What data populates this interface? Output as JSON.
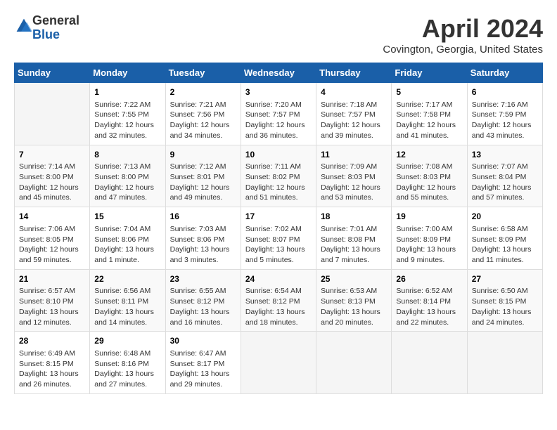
{
  "header": {
    "logo_general": "General",
    "logo_blue": "Blue",
    "month": "April 2024",
    "location": "Covington, Georgia, United States"
  },
  "days_of_week": [
    "Sunday",
    "Monday",
    "Tuesday",
    "Wednesday",
    "Thursday",
    "Friday",
    "Saturday"
  ],
  "weeks": [
    [
      {
        "day": "",
        "info": ""
      },
      {
        "day": "1",
        "info": "Sunrise: 7:22 AM\nSunset: 7:55 PM\nDaylight: 12 hours\nand 32 minutes."
      },
      {
        "day": "2",
        "info": "Sunrise: 7:21 AM\nSunset: 7:56 PM\nDaylight: 12 hours\nand 34 minutes."
      },
      {
        "day": "3",
        "info": "Sunrise: 7:20 AM\nSunset: 7:57 PM\nDaylight: 12 hours\nand 36 minutes."
      },
      {
        "day": "4",
        "info": "Sunrise: 7:18 AM\nSunset: 7:57 PM\nDaylight: 12 hours\nand 39 minutes."
      },
      {
        "day": "5",
        "info": "Sunrise: 7:17 AM\nSunset: 7:58 PM\nDaylight: 12 hours\nand 41 minutes."
      },
      {
        "day": "6",
        "info": "Sunrise: 7:16 AM\nSunset: 7:59 PM\nDaylight: 12 hours\nand 43 minutes."
      }
    ],
    [
      {
        "day": "7",
        "info": "Sunrise: 7:14 AM\nSunset: 8:00 PM\nDaylight: 12 hours\nand 45 minutes."
      },
      {
        "day": "8",
        "info": "Sunrise: 7:13 AM\nSunset: 8:00 PM\nDaylight: 12 hours\nand 47 minutes."
      },
      {
        "day": "9",
        "info": "Sunrise: 7:12 AM\nSunset: 8:01 PM\nDaylight: 12 hours\nand 49 minutes."
      },
      {
        "day": "10",
        "info": "Sunrise: 7:11 AM\nSunset: 8:02 PM\nDaylight: 12 hours\nand 51 minutes."
      },
      {
        "day": "11",
        "info": "Sunrise: 7:09 AM\nSunset: 8:03 PM\nDaylight: 12 hours\nand 53 minutes."
      },
      {
        "day": "12",
        "info": "Sunrise: 7:08 AM\nSunset: 8:03 PM\nDaylight: 12 hours\nand 55 minutes."
      },
      {
        "day": "13",
        "info": "Sunrise: 7:07 AM\nSunset: 8:04 PM\nDaylight: 12 hours\nand 57 minutes."
      }
    ],
    [
      {
        "day": "14",
        "info": "Sunrise: 7:06 AM\nSunset: 8:05 PM\nDaylight: 12 hours\nand 59 minutes."
      },
      {
        "day": "15",
        "info": "Sunrise: 7:04 AM\nSunset: 8:06 PM\nDaylight: 13 hours\nand 1 minute."
      },
      {
        "day": "16",
        "info": "Sunrise: 7:03 AM\nSunset: 8:06 PM\nDaylight: 13 hours\nand 3 minutes."
      },
      {
        "day": "17",
        "info": "Sunrise: 7:02 AM\nSunset: 8:07 PM\nDaylight: 13 hours\nand 5 minutes."
      },
      {
        "day": "18",
        "info": "Sunrise: 7:01 AM\nSunset: 8:08 PM\nDaylight: 13 hours\nand 7 minutes."
      },
      {
        "day": "19",
        "info": "Sunrise: 7:00 AM\nSunset: 8:09 PM\nDaylight: 13 hours\nand 9 minutes."
      },
      {
        "day": "20",
        "info": "Sunrise: 6:58 AM\nSunset: 8:09 PM\nDaylight: 13 hours\nand 11 minutes."
      }
    ],
    [
      {
        "day": "21",
        "info": "Sunrise: 6:57 AM\nSunset: 8:10 PM\nDaylight: 13 hours\nand 12 minutes."
      },
      {
        "day": "22",
        "info": "Sunrise: 6:56 AM\nSunset: 8:11 PM\nDaylight: 13 hours\nand 14 minutes."
      },
      {
        "day": "23",
        "info": "Sunrise: 6:55 AM\nSunset: 8:12 PM\nDaylight: 13 hours\nand 16 minutes."
      },
      {
        "day": "24",
        "info": "Sunrise: 6:54 AM\nSunset: 8:12 PM\nDaylight: 13 hours\nand 18 minutes."
      },
      {
        "day": "25",
        "info": "Sunrise: 6:53 AM\nSunset: 8:13 PM\nDaylight: 13 hours\nand 20 minutes."
      },
      {
        "day": "26",
        "info": "Sunrise: 6:52 AM\nSunset: 8:14 PM\nDaylight: 13 hours\nand 22 minutes."
      },
      {
        "day": "27",
        "info": "Sunrise: 6:50 AM\nSunset: 8:15 PM\nDaylight: 13 hours\nand 24 minutes."
      }
    ],
    [
      {
        "day": "28",
        "info": "Sunrise: 6:49 AM\nSunset: 8:15 PM\nDaylight: 13 hours\nand 26 minutes."
      },
      {
        "day": "29",
        "info": "Sunrise: 6:48 AM\nSunset: 8:16 PM\nDaylight: 13 hours\nand 27 minutes."
      },
      {
        "day": "30",
        "info": "Sunrise: 6:47 AM\nSunset: 8:17 PM\nDaylight: 13 hours\nand 29 minutes."
      },
      {
        "day": "",
        "info": ""
      },
      {
        "day": "",
        "info": ""
      },
      {
        "day": "",
        "info": ""
      },
      {
        "day": "",
        "info": ""
      }
    ]
  ]
}
